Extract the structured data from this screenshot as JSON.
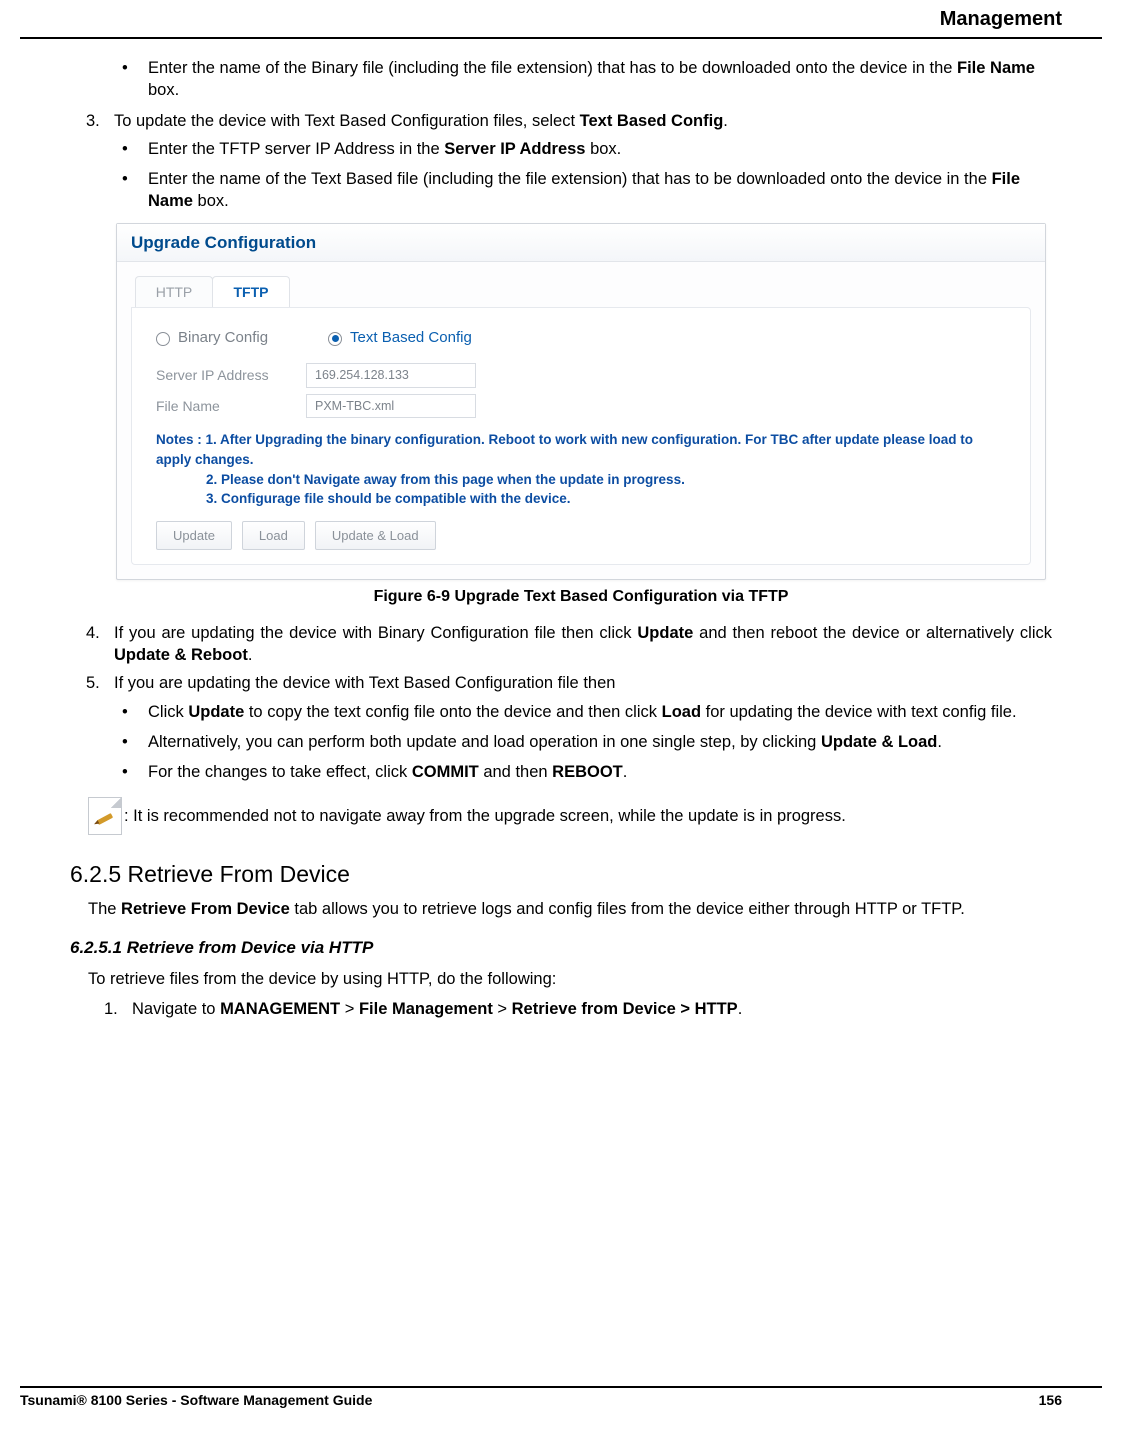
{
  "header": {
    "title": "Management"
  },
  "body": {
    "b1_full": "Enter the name of the Binary file (including the file extension) that has to be downloaded onto the device in the File Name box.",
    "b1_a": "Enter the name of the Binary file (including the file extension) that has to be downloaded onto the device in the ",
    "b1_bold": "File Name",
    "b1_c": " box.",
    "n3_a": "To update the device with Text Based Configuration files, select ",
    "n3_bold": "Text Based Config",
    "n3_c": ".",
    "b2_a": "Enter the TFTP server IP Address in the ",
    "b2_bold": "Server IP Address",
    "b2_c": " box.",
    "b3_a": "Enter the name of the Text Based file (including the file extension) that has to be downloaded onto the device in the ",
    "b3_bold": "File Name",
    "b3_c": " box.",
    "fig_caption": "Figure 6-9 Upgrade Text Based Configuration via TFTP",
    "n4_a": "If you are updating the device with Binary Configuration file then click ",
    "n4_bold1": "Update",
    "n4_b": " and then reboot the device or alternatively click ",
    "n4_bold2": "Update & Reboot",
    "n4_c": ".",
    "n5": "If you are updating the device with Text Based Configuration file then",
    "b4_a": "Click ",
    "b4_bold1": "Update",
    "b4_b": " to copy the text config file onto the device and then click ",
    "b4_bold2": "Load",
    "b4_c": " for updating the device with text config file.",
    "b5_a": "Alternatively, you can perform both update and load operation in one single step, by clicking ",
    "b5_bold": "Update & Load",
    "b5_c": ".",
    "b6_a": "For the changes to take effect, click ",
    "b6_bold1": "COMMIT",
    "b6_b": " and then ",
    "b6_bold2": "REBOOT",
    "b6_c": ".",
    "note_text": ": It is recommended not to navigate away from the upgrade screen, while the update is in progress.",
    "sec_625": "6.2.5 Retrieve From Device",
    "sec_625_p_a": "The ",
    "sec_625_p_bold": "Retrieve From Device",
    "sec_625_p_b": " tab allows you to retrieve logs and config files from the device either through HTTP or TFTP.",
    "sec_6251": "6.2.5.1 Retrieve from Device via HTTP",
    "sec_6251_p": "To retrieve files from the device by using HTTP, do the following:",
    "sec_6251_n1_a": "Navigate to ",
    "sec_6251_n1_b1": "MANAGEMENT",
    "sec_6251_n1_gt1": " > ",
    "sec_6251_n1_b2": "File Management",
    "sec_6251_n1_gt2": " > ",
    "sec_6251_n1_b3": "Retrieve from Device > HTTP",
    "sec_6251_n1_c": "."
  },
  "screenshot": {
    "title": "Upgrade Configuration",
    "tabs": {
      "http": "HTTP",
      "tftp": "TFTP"
    },
    "radio": {
      "binary": "Binary Config",
      "text": "Text Based Config"
    },
    "fields": {
      "server_ip_label": "Server IP Address",
      "server_ip_value": "169.254.128.133",
      "file_name_label": "File Name",
      "file_name_value": "PXM-TBC.xml"
    },
    "notes_prefix": "Notes : 1. ",
    "note1": "After Upgrading the binary configuration. Reboot to work with new configuration. For TBC after update please load to apply changes.",
    "note2": "2. Please don't Navigate away from this page when the update in progress.",
    "note3": "3. Configurage file should be compatible with the device.",
    "buttons": {
      "update": "Update",
      "load": "Load",
      "update_load": "Update & Load"
    }
  },
  "footer": {
    "left": "Tsunami® 8100 Series - Software Management Guide",
    "right": "156"
  }
}
